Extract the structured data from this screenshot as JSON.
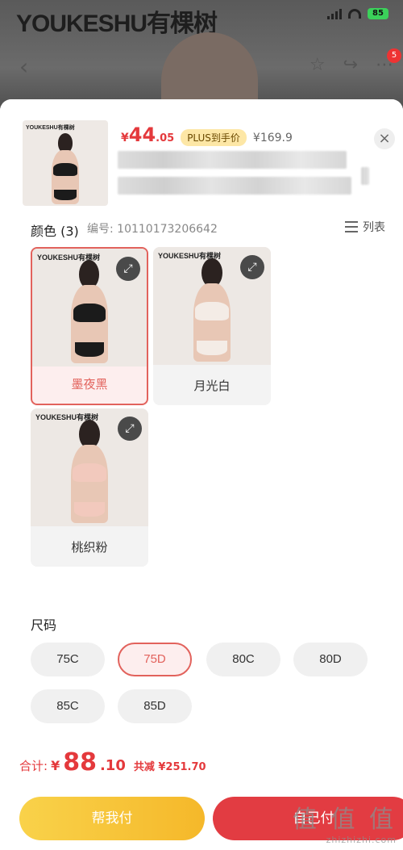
{
  "background": {
    "brand": "YOUKESHU有棵树",
    "battery": "85",
    "cart_count": "5"
  },
  "product": {
    "thumb_logo": "YOUKESHU有棵树",
    "price_symbol": "¥",
    "price_int": "44",
    "price_dec": ".05",
    "plus_tag": "PLUS到手价",
    "original_price": "¥169.9"
  },
  "color_section": {
    "title": "颜色 (3)",
    "code": "编号: 10110173206642",
    "list_label": "列表",
    "swatches": [
      {
        "name": "墨夜黑",
        "logo": "YOUKESHU有棵树",
        "tint": "#1b1b1b",
        "selected": true
      },
      {
        "name": "月光白",
        "logo": "YOUKESHU有棵树",
        "tint": "#f4ece6",
        "selected": false
      },
      {
        "name": "桃织粉",
        "logo": "YOUKESHU有棵树",
        "tint": "#f2c9bd",
        "selected": false
      }
    ]
  },
  "size_section": {
    "title": "尺码",
    "sizes": [
      "75C",
      "75D",
      "80C",
      "80D",
      "85C",
      "85D"
    ],
    "selected": "75D"
  },
  "footer": {
    "total_label": "合计:",
    "total_symbol": "¥",
    "total_int": "88",
    "total_dec": ".10",
    "total_saved": "共减 ¥251.70",
    "help_pay_button": "帮我付",
    "self_pay_button": "自己付",
    "watermark": "值 值 值",
    "watermark_site": "zhizhizhi.com"
  }
}
